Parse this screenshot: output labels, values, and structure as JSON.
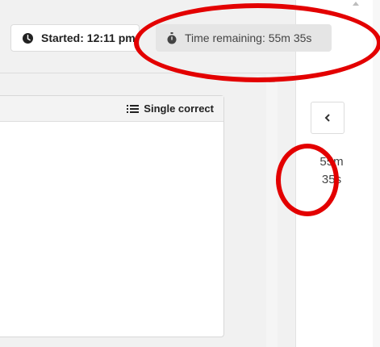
{
  "header": {
    "started_label": "Started: 12:11 pm",
    "time_remaining_label": "Time remaining: 55m 35s"
  },
  "question_card": {
    "type_label": "Single correct"
  },
  "side_panel": {
    "collapse_icon": "chevron-left-icon",
    "time_remaining": "55m 35s",
    "time_minutes": "55m",
    "time_seconds": "35s"
  },
  "colors": {
    "annotation": "#e30000",
    "pill_background": "#e5e5e5",
    "main_background": "#f1f1f1"
  }
}
